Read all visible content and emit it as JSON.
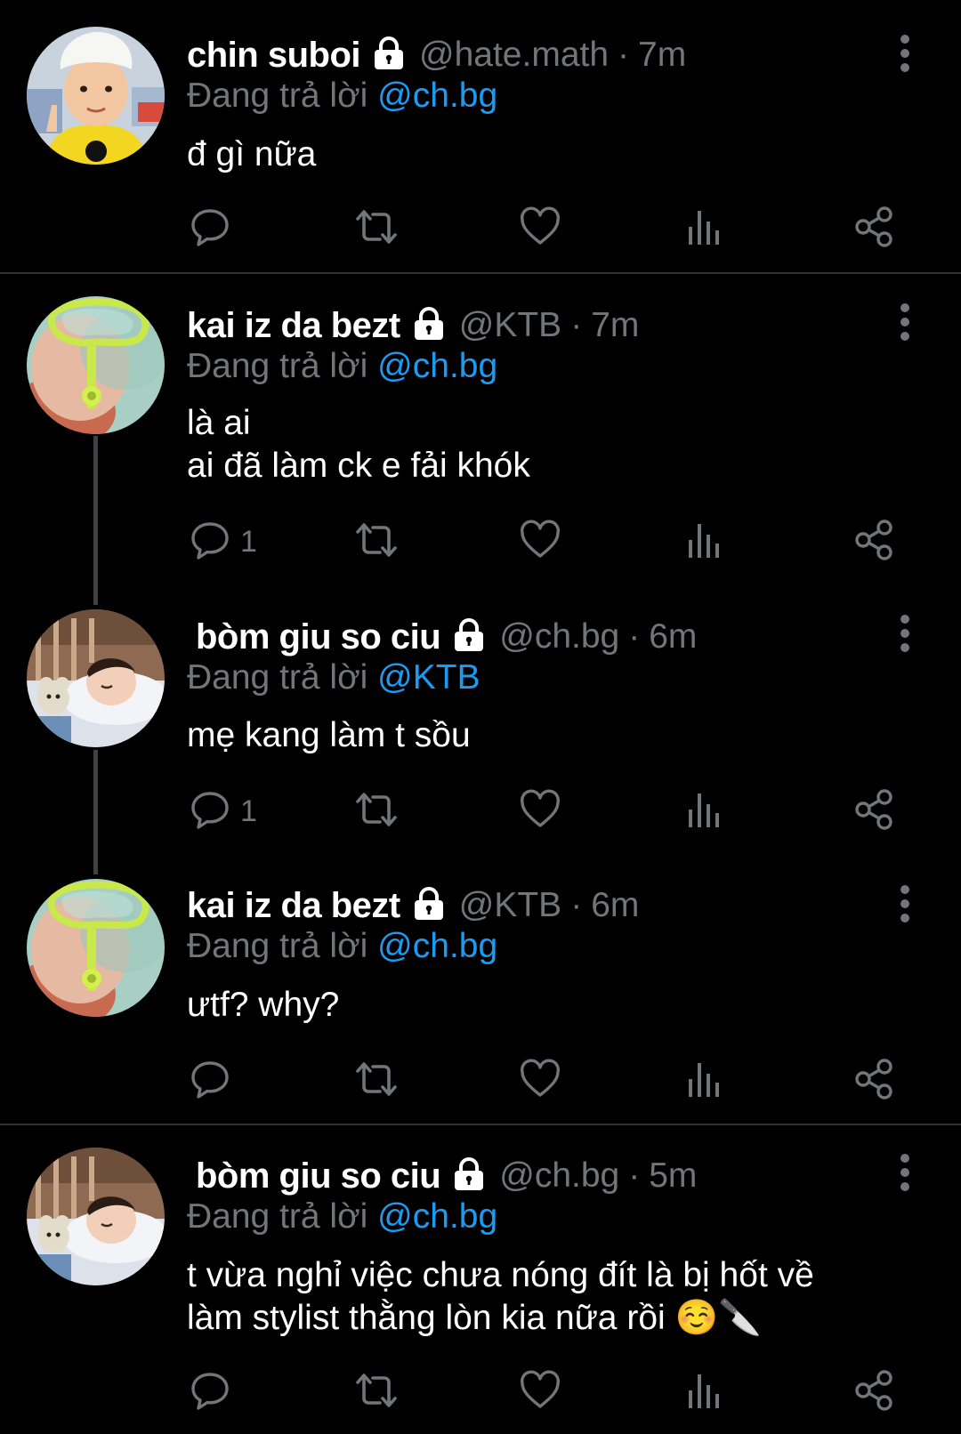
{
  "colors": {
    "background": "#000000",
    "name": "#FFFFFF",
    "muted": "#71767B",
    "link": "#1D9BF0",
    "divider": "#2F3336",
    "thread_line": "#3E4144"
  },
  "icons": {
    "lock": "lock-icon",
    "more": "more-vertical-icon",
    "reply": "reply-icon",
    "retweet": "retweet-icon",
    "like": "heart-icon",
    "views": "views-icon",
    "share": "share-icon"
  },
  "reply_prefix": "Đang trả lời",
  "tweets": [
    {
      "name": "chin suboi",
      "handle": "@hate.math",
      "separator": "·",
      "time": "7m",
      "reply_to": "@ch.bg",
      "lines": [
        "đ gì nữa",
        ""
      ],
      "reply_count": ""
    },
    {
      "name": "kai iz da bezt",
      "handle": "@KTB",
      "separator": "·",
      "time": "7m",
      "reply_to": "@ch.bg",
      "lines": [
        "là ai",
        "ai đã làm ck e fải khók"
      ],
      "reply_count": "1"
    },
    {
      "name": "bòm giu so ciu",
      "handle": "@ch.bg",
      "separator": "·",
      "time": "6m",
      "reply_to": "@KTB",
      "lines": [
        "mẹ kang làm t sồu",
        ""
      ],
      "reply_count": "1"
    },
    {
      "name": "kai iz da bezt",
      "handle": "@KTB",
      "separator": "·",
      "time": "6m",
      "reply_to": "@ch.bg",
      "lines": [
        "ưtf? why?",
        ""
      ],
      "reply_count": ""
    },
    {
      "name": "bòm giu so ciu",
      "handle": "@ch.bg",
      "separator": "·",
      "time": "5m",
      "reply_to": "@ch.bg",
      "lines": [
        "t vừa nghỉ việc chưa nóng đít là bị hốt về",
        "làm stylist thằng lòn kia nữa rồi ☺️🔪"
      ],
      "reply_count": ""
    }
  ]
}
